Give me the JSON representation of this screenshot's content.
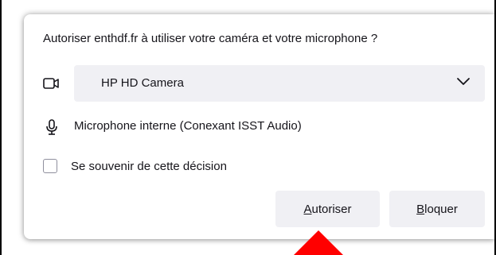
{
  "prompt": {
    "question": "Autoriser enthdf.fr à utiliser votre caméra et votre microphone ?"
  },
  "camera": {
    "icon": "camera-icon",
    "selected": "HP HD Camera"
  },
  "microphone": {
    "icon": "microphone-icon",
    "label": "Microphone interne (Conexant ISST Audio)"
  },
  "remember": {
    "label": "Se souvenir de cette décision",
    "checked": false
  },
  "buttons": {
    "allow_access_key": "A",
    "allow_rest": "utoriser",
    "block_access_key": "B",
    "block_rest": "loquer"
  },
  "annotation": {
    "arrow_color": "#ff0000"
  },
  "colors": {
    "button_bg": "#f0f0f4",
    "text": "#15141a"
  }
}
